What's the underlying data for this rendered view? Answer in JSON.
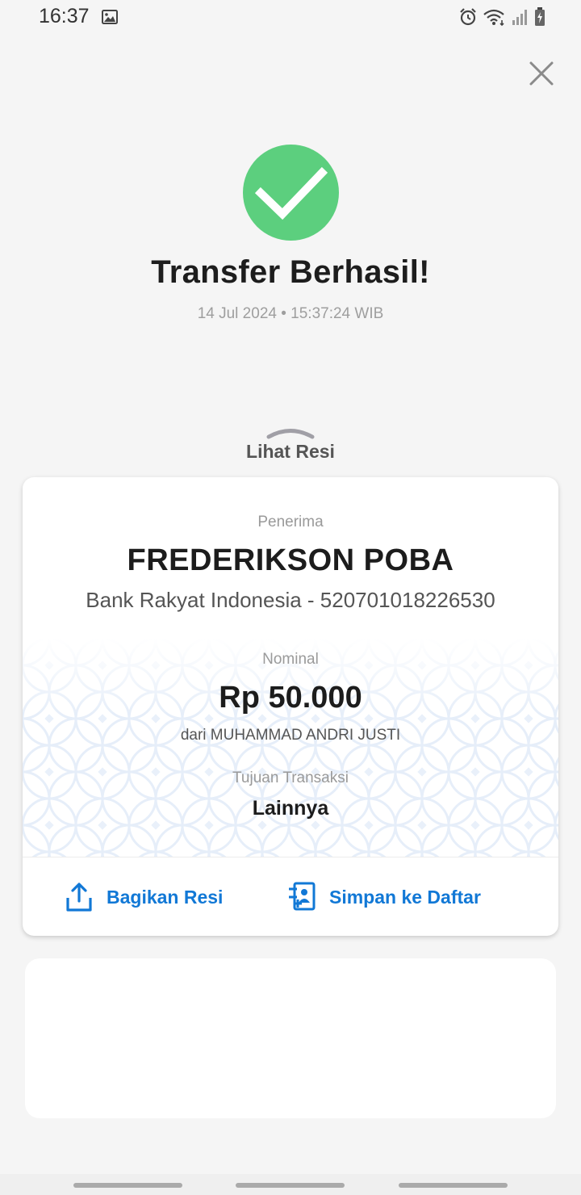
{
  "status_bar": {
    "time": "16:37",
    "icons": [
      "gallery-icon",
      "alarm-icon",
      "wifi-icon",
      "signal-icon",
      "battery-icon"
    ]
  },
  "header": {
    "close_icon": "close-icon"
  },
  "result": {
    "icon": "check-circle-icon",
    "icon_color": "#5ccf7e",
    "title": "Transfer Berhasil!",
    "datetime": "14 Jul 2024 • 15:37:24 WIB"
  },
  "receipt_toggle": {
    "label": "Lihat Resi",
    "icon": "chevron-up-icon"
  },
  "receipt": {
    "recipient_label": "Penerima",
    "recipient_name": "FREDERIKSON POBA",
    "recipient_bank": "Bank Rakyat Indonesia - 520701018226530",
    "amount_label": "Nominal",
    "amount": "Rp 50.000",
    "sender": "dari MUHAMMAD ANDRI JUSTI",
    "purpose_label": "Tujuan Transaksi",
    "purpose": "Lainnya",
    "actions": {
      "share_label": "Bagikan Resi",
      "share_icon": "share-icon",
      "save_label": "Simpan ke Daftar",
      "save_icon": "add-contact-icon"
    }
  },
  "colors": {
    "accent": "#1178d6",
    "success": "#5ccf7e",
    "background": "#f5f5f5"
  }
}
